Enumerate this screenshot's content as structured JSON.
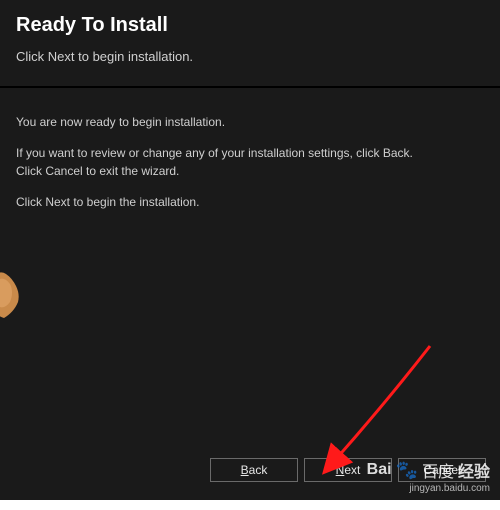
{
  "header": {
    "title": "Ready To Install",
    "subtitle": "Click Next to begin installation."
  },
  "content": {
    "line1": "You are now ready to begin installation.",
    "line2_a": "If you want to review or change any of your installation settings, click Back.",
    "line2_b": "Click Cancel to exit the wizard.",
    "line3": "Click Next to begin the installation."
  },
  "buttons": {
    "back_prefix": "B",
    "back_rest": "ack",
    "next_prefix": "N",
    "next_rest": "ext",
    "cancel": "Cancel"
  },
  "watermark": {
    "brand_main": "Bai",
    "brand_paw": "🐾",
    "brand_sub": "百度",
    "brand_tail": "经验",
    "url": "jingyan.baidu.com"
  }
}
